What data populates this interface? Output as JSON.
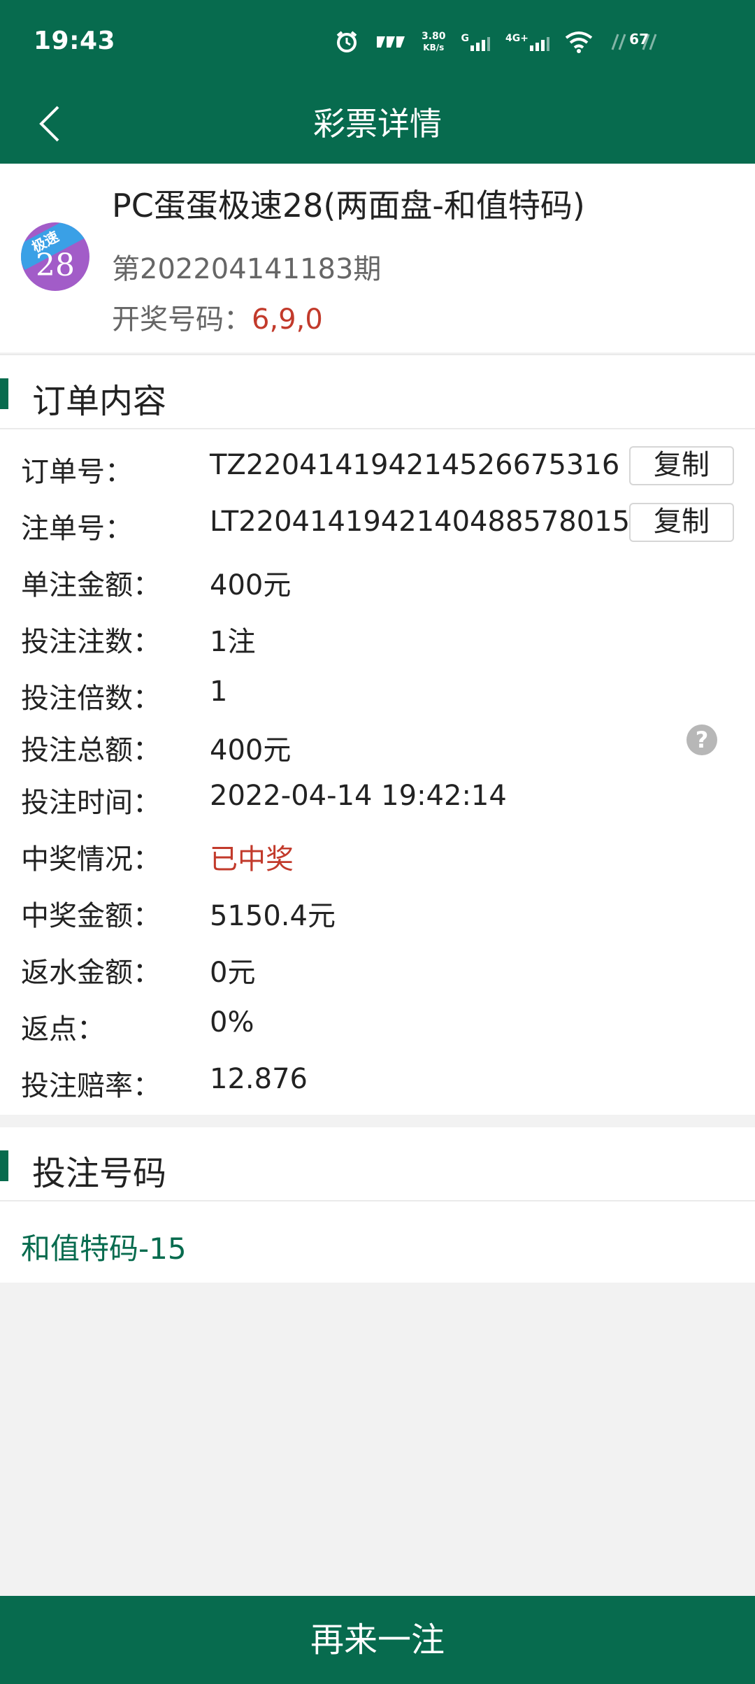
{
  "status_bar": {
    "time": "19:43",
    "net_speed_value": "3.80",
    "net_speed_unit": "KB/s",
    "network_g": "G",
    "network_4g": "4G+",
    "battery": "67"
  },
  "nav": {
    "title": "彩票详情",
    "back_icon": "chevron-left-icon"
  },
  "lottery": {
    "logo_band_text": "极速",
    "logo_number": "28",
    "name": "PC蛋蛋极速28(两面盘-和值特码)",
    "issue": "第202204141183期",
    "draw_label": "开奖号码：",
    "draw_numbers": "6,9,0"
  },
  "order": {
    "section_title": "订单内容",
    "copy_label": "复制",
    "rows": [
      {
        "label": "订单号：",
        "value": "TZ220414194214526675316"
      },
      {
        "label": "注单号：",
        "value": "LT2204141942140488578015"
      },
      {
        "label": "单注金额：",
        "value": "400元"
      },
      {
        "label": "投注注数：",
        "value": "1注"
      },
      {
        "label": "投注倍数：",
        "value": "1"
      },
      {
        "label": "投注总额：",
        "value": "400元"
      },
      {
        "label": "投注时间：",
        "value": "2022-04-14 19:42:14"
      },
      {
        "label": "中奖情况：",
        "value": "已中奖"
      },
      {
        "label": "中奖金额：",
        "value": "5150.4元"
      },
      {
        "label": "返水金额：",
        "value": "0元"
      },
      {
        "label": "返点：",
        "value": "0%"
      },
      {
        "label": "投注赔率：",
        "value": "12.876"
      }
    ],
    "help_glyph": "?"
  },
  "bet_numbers": {
    "section_title": "投注号码",
    "value": "和值特码-15"
  },
  "bottom_button": {
    "label": "再来一注"
  },
  "colors": {
    "primary": "#076b4e",
    "accent_red": "#c23a2b"
  }
}
